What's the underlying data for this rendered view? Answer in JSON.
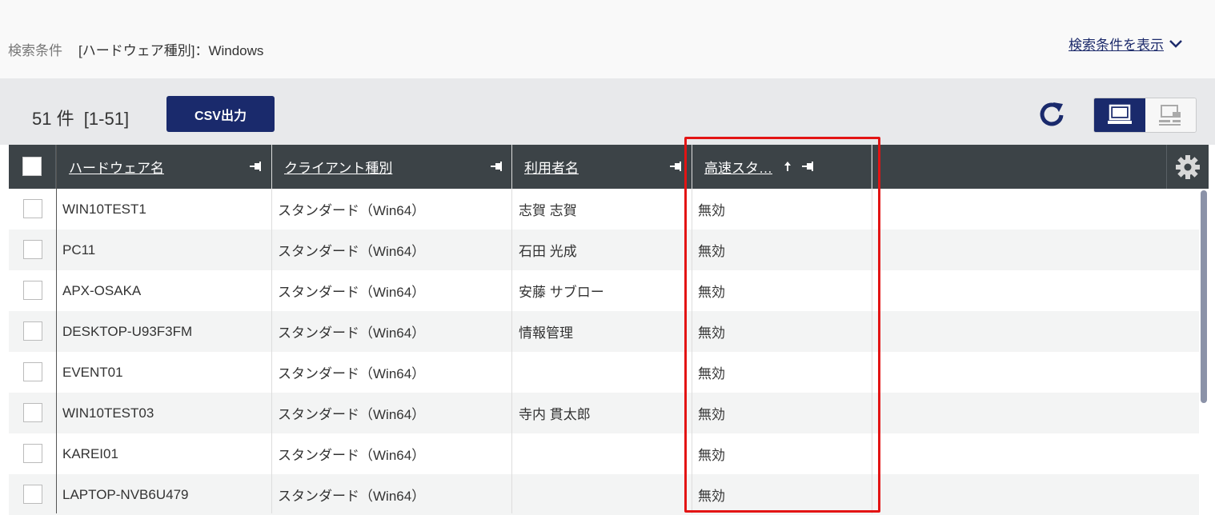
{
  "filter": {
    "label": "検索条件",
    "value": "[ハードウェア種別]：Windows",
    "show_label": "検索条件を表示"
  },
  "toolbar": {
    "count": "51 件  [1-51]",
    "csv_label": "CSV出力"
  },
  "columns": [
    {
      "label": "ハードウェア名"
    },
    {
      "label": "クライアント種別"
    },
    {
      "label": "利用者名"
    },
    {
      "label": "高速スタ…"
    }
  ],
  "rows": [
    {
      "name": "WIN10TEST1",
      "type": "スタンダード（Win64）",
      "user": "志賀 志賀",
      "fast": "無効"
    },
    {
      "name": "PC11",
      "type": "スタンダード（Win64）",
      "user": "石田 光成",
      "fast": "無効"
    },
    {
      "name": "APX-OSAKA",
      "type": "スタンダード（Win64）",
      "user": "安藤 サブロー",
      "fast": "無効"
    },
    {
      "name": "DESKTOP-U93F3FM",
      "type": "スタンダード（Win64）",
      "user": "情報管理",
      "fast": "無効"
    },
    {
      "name": "EVENT01",
      "type": "スタンダード（Win64）",
      "user": "",
      "fast": "無効"
    },
    {
      "name": "WIN10TEST03",
      "type": "スタンダード（Win64）",
      "user": "寺内 貫太郎",
      "fast": "無効"
    },
    {
      "name": "KAREI01",
      "type": "スタンダード（Win64）",
      "user": "",
      "fast": "無効"
    },
    {
      "name": "LAPTOP-NVB6U479",
      "type": "スタンダード（Win64）",
      "user": "",
      "fast": "無効"
    }
  ],
  "icons": {
    "show": "chevron-down-icon",
    "refresh": "refresh-icon",
    "view_pc": "computer-icon",
    "view_tree": "network-icon",
    "settings": "gear-icon",
    "pin": "pin-icon",
    "sort": "sort-up-icon"
  },
  "colors": {
    "primary": "#1a2a6c",
    "header_bg": "#3c4347",
    "highlight": "#e31414"
  }
}
